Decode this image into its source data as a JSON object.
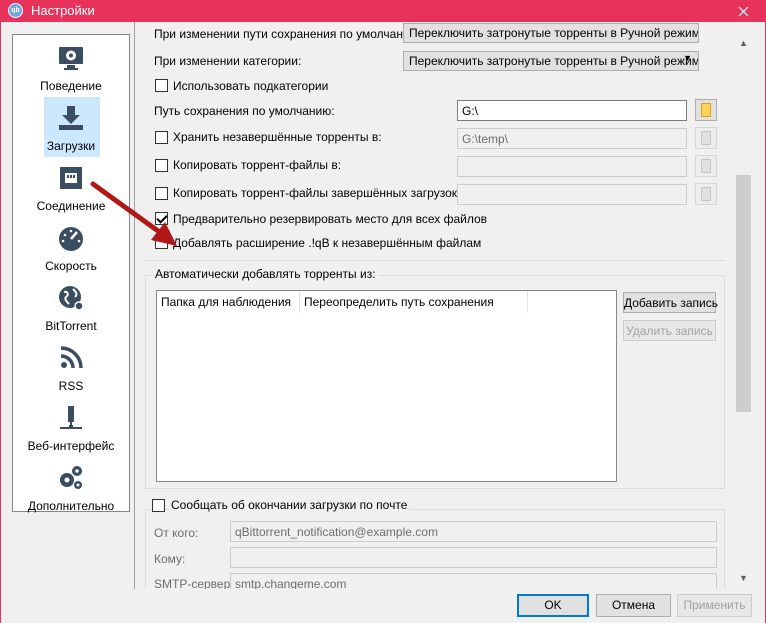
{
  "window": {
    "title": "Настройки",
    "app_icon_text": "qb",
    "close_glyph": "✕"
  },
  "sidebar": {
    "items": [
      {
        "label": "Поведение",
        "icon": "monitor-gear-icon"
      },
      {
        "label": "Загрузки",
        "icon": "download-icon",
        "selected": true
      },
      {
        "label": "Соединение",
        "icon": "network-port-icon"
      },
      {
        "label": "Скорость",
        "icon": "speedometer-icon"
      },
      {
        "label": "BitTorrent",
        "icon": "globe-icon"
      },
      {
        "label": "RSS",
        "icon": "rss-icon"
      },
      {
        "label": "Веб-интерфейс",
        "icon": "web-ui-icon"
      },
      {
        "label": "Дополнительно",
        "icon": "gears-icon"
      }
    ]
  },
  "downloads": {
    "top_cut_label": "При изменении пути сохранения по умолчанию:",
    "top_cut_value": "Переключить затронутые торренты в Ручной режим",
    "category_change_label": "При изменении категории:",
    "category_change_value": "Переключить затронутые торренты в Ручной режим",
    "use_subcategories_label": "Использовать подкатегории",
    "default_save_path_label": "Путь сохранения по умолчанию:",
    "default_save_path_value": "G:\\",
    "keep_incomplete_label": "Хранить незавершённые торренты в:",
    "keep_incomplete_value": "G:\\temp\\",
    "copy_torrents_label": "Копировать торрент-файлы в:",
    "copy_finished_label": "Копировать торрент-файлы завершённых загрузок в:",
    "preallocate_label": "Предварительно резервировать место для всех файлов",
    "preallocate_checked": true,
    "append_ext_label": "Добавлять расширение .!qB к незавершённым файлам",
    "append_ext_checked": false
  },
  "watch": {
    "group_label": "Автоматически добавлять торренты из:",
    "columns": [
      "Папка для наблюдения",
      "Переопределить путь сохранения"
    ],
    "add_button": "Добавить запись",
    "remove_button": "Удалить запись"
  },
  "email": {
    "notify_label": "Сообщать об окончании загрузки по почте",
    "from_label": "От кого:",
    "from_value": "qBittorrent_notification@example.com",
    "to_label": "Кому:",
    "to_value": "",
    "smtp_label": "SMTP-сервер:",
    "smtp_value": "smtp.changeme.com"
  },
  "buttons": {
    "ok": "OK",
    "cancel": "Отмена",
    "apply": "Применить"
  },
  "colors": {
    "titlebar": "#e7335c",
    "arrow": "#d01f1f",
    "selection": "#cce8ff",
    "default_button_border": "#0078d7"
  }
}
